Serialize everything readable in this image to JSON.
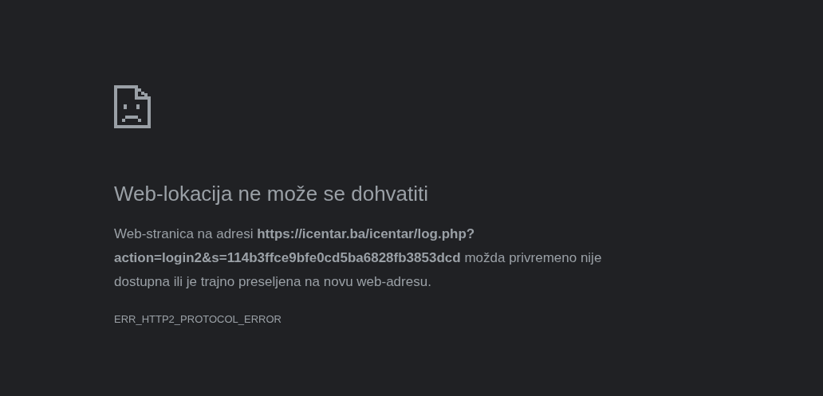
{
  "error": {
    "title": "Web-lokacija ne može se dohvatiti",
    "message": "Web-stranica na adresi **https://icentar.ba/icentar/log.php?action=login2&s=114b3ffce9bfe0cd5ba6828fb3853dcd** možda privremeno nije dostupna ili je trajno preseljena na novu web-adresu.",
    "code": "ERR_HTTP2_PROTOCOL_ERROR"
  }
}
